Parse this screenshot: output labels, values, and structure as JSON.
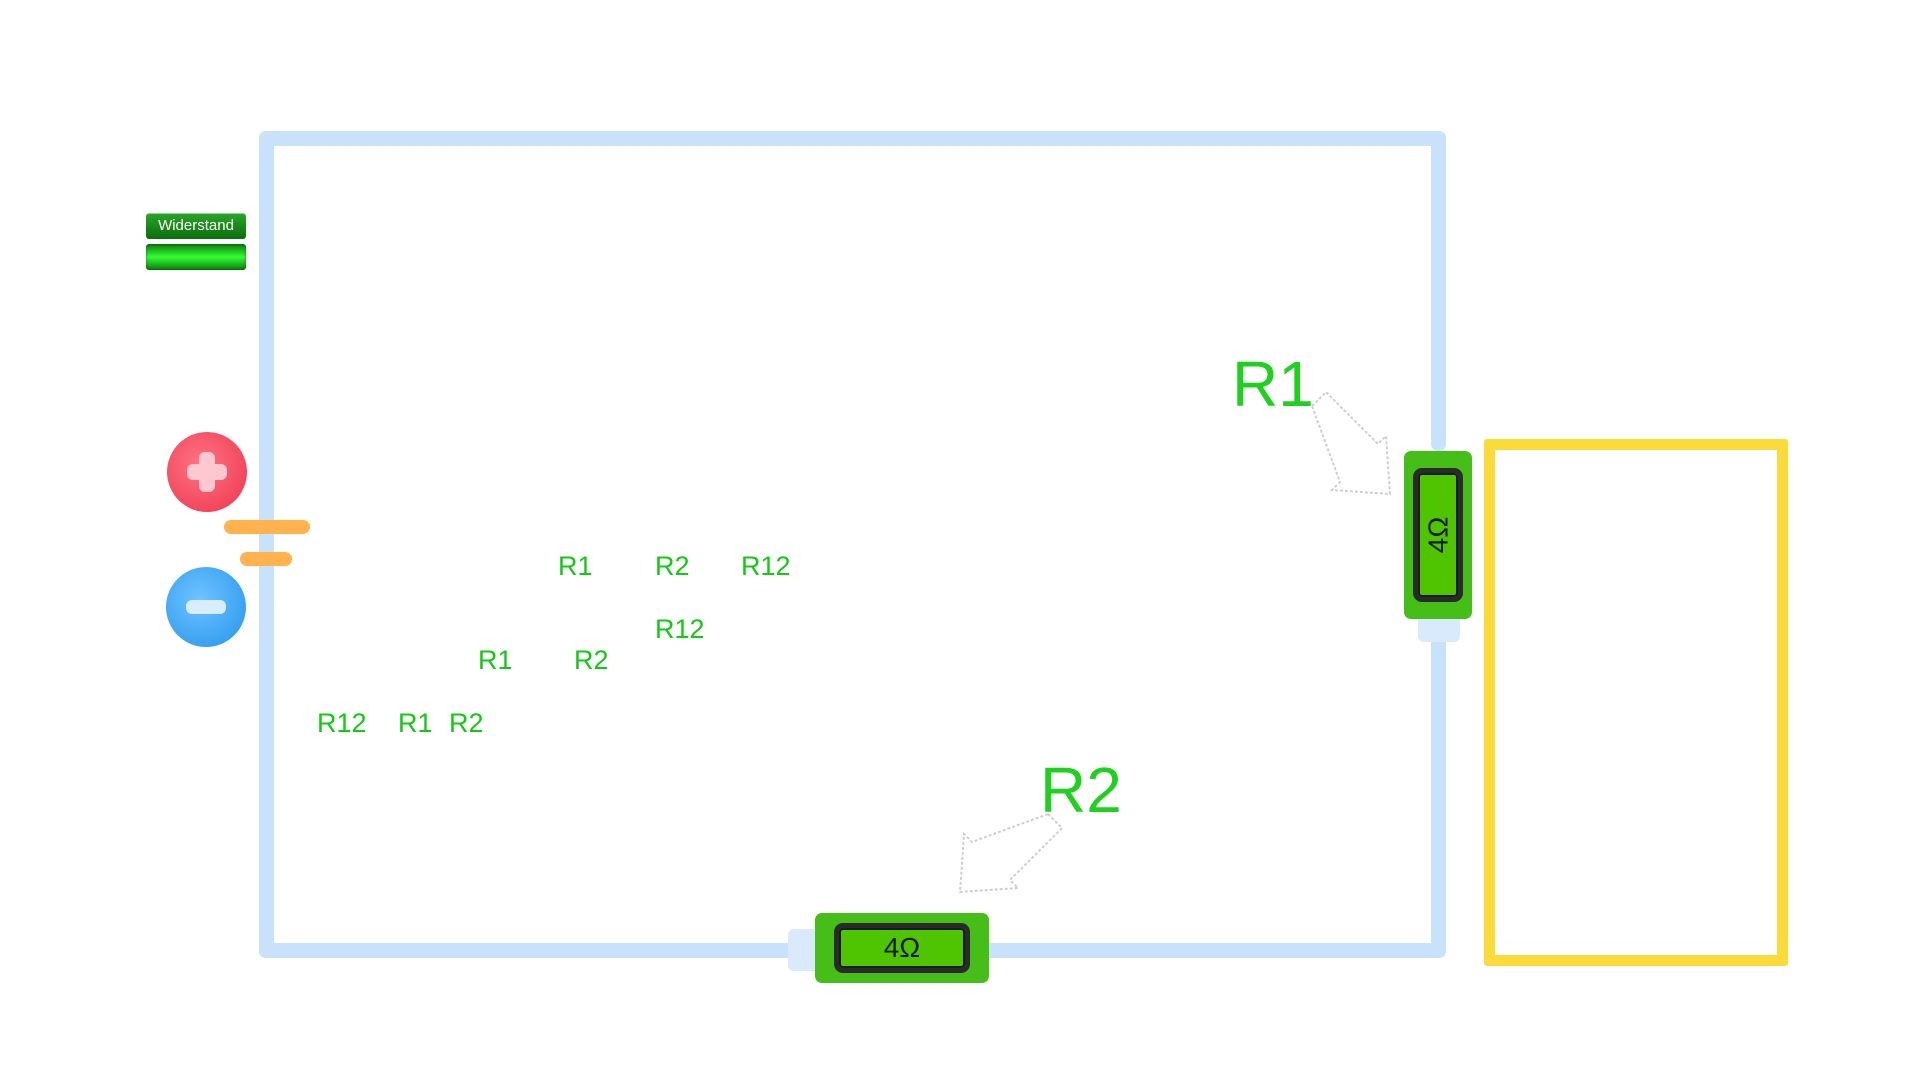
{
  "palette": {
    "widerstand_label": "Widerstand"
  },
  "resistors": [
    {
      "id": "R1",
      "label": "R1",
      "value": "4Ω",
      "orientation": "vertical"
    },
    {
      "id": "R2",
      "label": "R2",
      "value": "4Ω",
      "orientation": "horizontal"
    }
  ],
  "drop_labels": {
    "row1": [
      "R1",
      "R2",
      "R12"
    ],
    "row2": [
      "R12"
    ],
    "row3": [
      "R1",
      "R2"
    ],
    "row4": [
      "R12",
      "R1",
      "R2"
    ]
  },
  "colors": {
    "wire": "#c9e2fb",
    "resistor_body": "#45bf18",
    "label_green": "#1fd11f",
    "measure_box_border": "#fbdb3a",
    "plus_terminal": "#f2475c",
    "minus_terminal": "#3aa2f2",
    "battery_plate": "#ffb24e"
  },
  "icons": {
    "plus_terminal": "plus-icon",
    "minus_terminal": "minus-icon",
    "pointer_arrows": "arrow-icon"
  }
}
